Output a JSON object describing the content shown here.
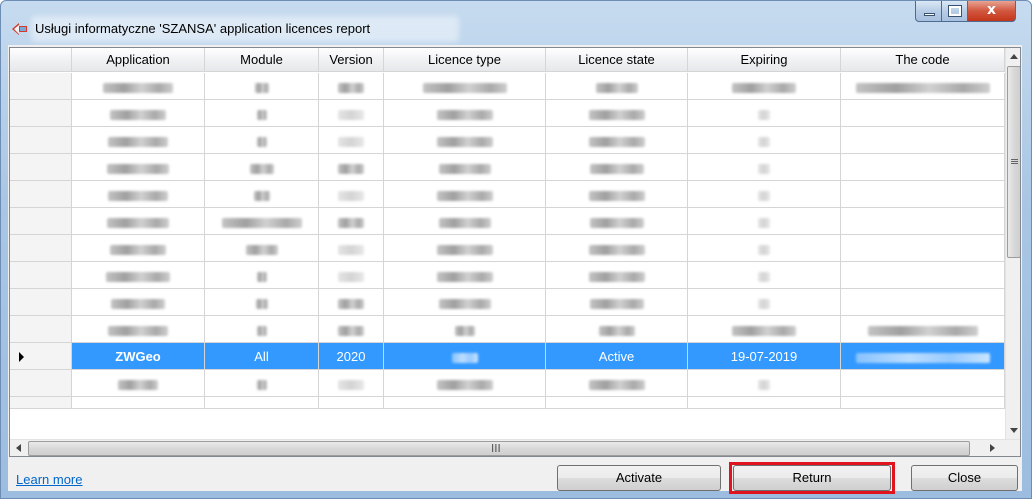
{
  "window": {
    "title": "Usługi informatyczne 'SZANSA' application licences report",
    "controls": {
      "close_glyph": "x"
    }
  },
  "grid": {
    "columns": [
      "Application",
      "Module",
      "Version",
      "Licence type",
      "Licence state",
      "Expiring",
      "The code"
    ],
    "selected_row": {
      "application": "ZWGeo",
      "module": "All",
      "version": "2020",
      "licence_state": "Active",
      "expiring": "19-07-2019"
    },
    "hscroll_grip": "III"
  },
  "footer": {
    "learn_more": "Learn more",
    "activate": "Activate",
    "return": "Return",
    "close": "Close"
  },
  "colors": {
    "selection": "#3399ff",
    "highlight_box": "#e0141e",
    "link": "#0066cc"
  }
}
